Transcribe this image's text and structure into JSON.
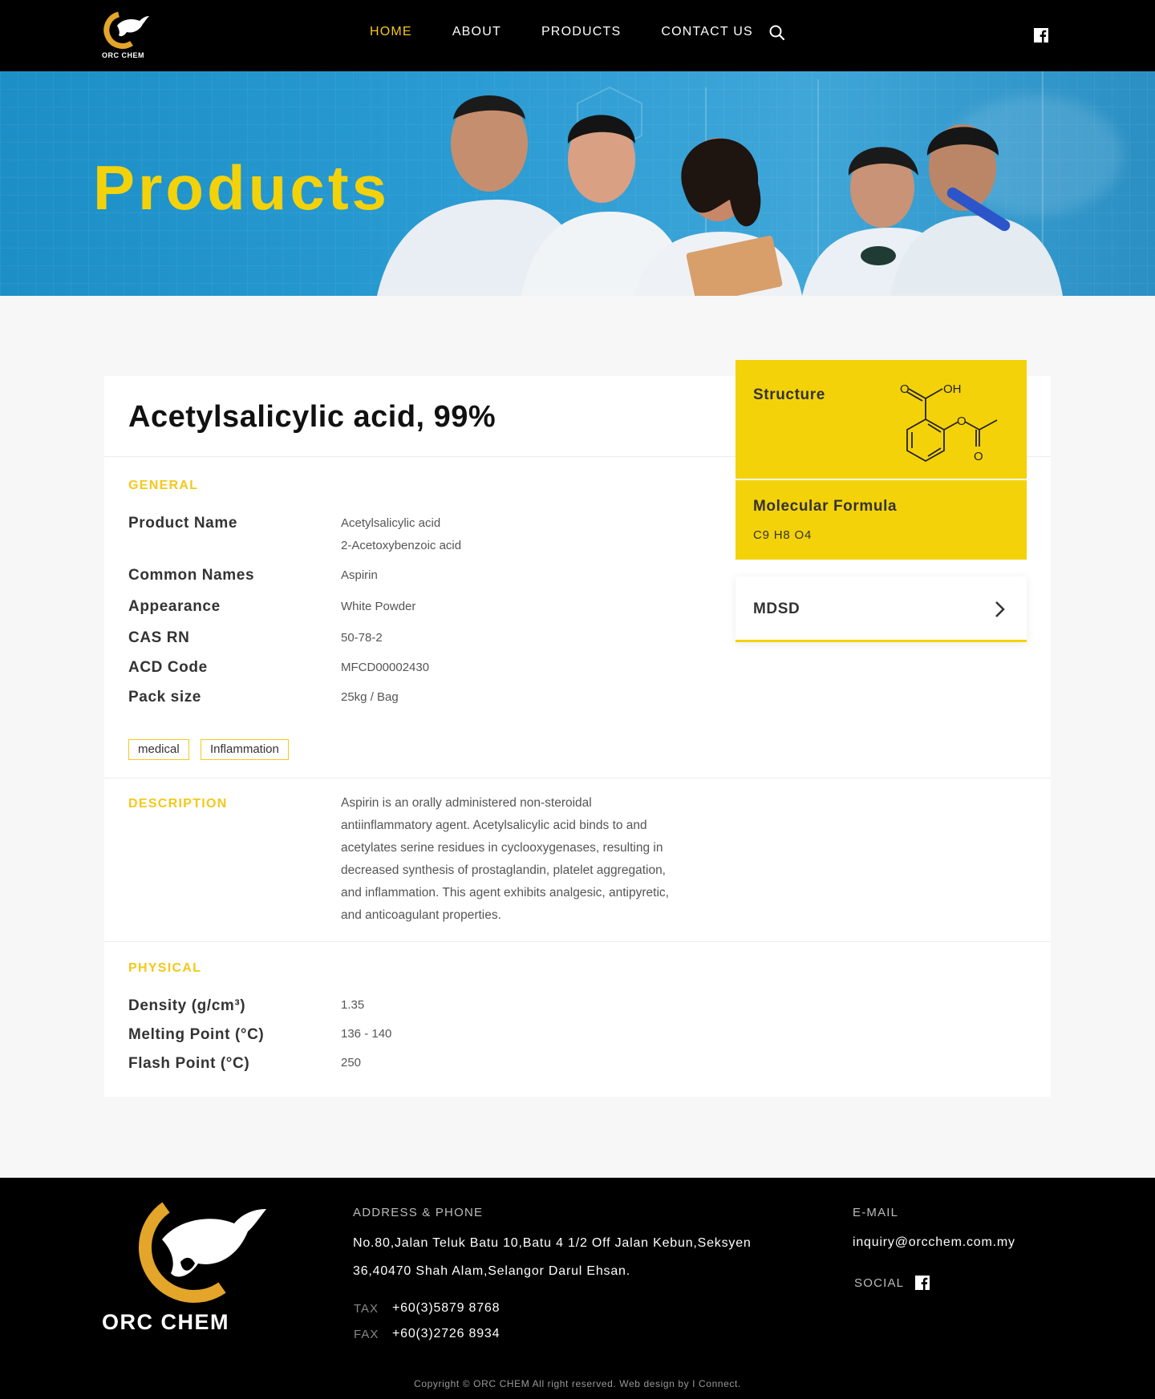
{
  "header": {
    "brand": "ORC CHEM",
    "nav": [
      "HOME",
      "ABOUT",
      "PRODUCTS",
      "CONTACT US"
    ],
    "active_nav": "HOME",
    "icons": [
      "search-icon",
      "facebook-icon"
    ]
  },
  "hero": {
    "title": "Products"
  },
  "product": {
    "title": "Acetylsalicylic acid, 99%",
    "general_label": "GENERAL",
    "general": [
      {
        "label": "Product Name",
        "value": "Acetylsalicylic acid",
        "value2": "2-Acetoxybenzoic acid"
      },
      {
        "label": "Common Names",
        "value": "Aspirin"
      },
      {
        "label": "Appearance",
        "value": "White Powder"
      },
      {
        "label": "CAS RN",
        "value": "50-78-2"
      },
      {
        "label": "ACD Code",
        "value": "MFCD00002430"
      },
      {
        "label": "Pack size",
        "value": "25kg / Bag"
      }
    ],
    "tags": [
      "medical",
      "Inflammation"
    ],
    "description_label": "DESCRIPTION",
    "description": "Aspirin is an orally administered non-steroidal antiinflammatory agent. Acetylsalicylic acid binds to and acetylates serine residues in cyclooxygenases, resulting in decreased synthesis of prostaglandin, platelet aggregation, and inflammation. This agent exhibits analgesic, antipyretic, and anticoagulant properties.",
    "physical_label": "PHYSICAL",
    "physical": [
      {
        "label": "Density (g/cm³)",
        "value": "1.35"
      },
      {
        "label": "Melting Point (°C)",
        "value": "136 - 140"
      },
      {
        "label": "Flash Point (°C)",
        "value": "250"
      }
    ]
  },
  "side": {
    "structure_label": "Structure",
    "structure_atoms": {
      "o1": "O",
      "oh": "OH",
      "o2": "O",
      "o3": "O"
    },
    "formula_label": "Molecular Formula",
    "formula_value": "C9 H8 O4",
    "mdsd_label": "MDSD"
  },
  "footer": {
    "brand": "ORC CHEM",
    "address_head": "ADDRESS & PHONE",
    "address_line1": "No.80,Jalan Teluk Batu 10,Batu 4 1/2 Off Jalan Kebun,Seksyen",
    "address_line2": "36,40470 Shah Alam,Selangor Darul Ehsan.",
    "tax_key": "TAX",
    "tax_val": "+60(3)5879 8768",
    "fax_key": "FAX",
    "fax_val": "+60(3)2726 8934",
    "email_head": "E-MAIL",
    "email": "inquiry@orcchem.com.my",
    "social_head": "SOCIAL",
    "copyright": "Copyright © ORC CHEM All right reserved. Web design by I Connect."
  },
  "colors": {
    "accent": "#f4d20a",
    "header_bg": "#000000",
    "hero_blue": "#2a9bd3"
  }
}
